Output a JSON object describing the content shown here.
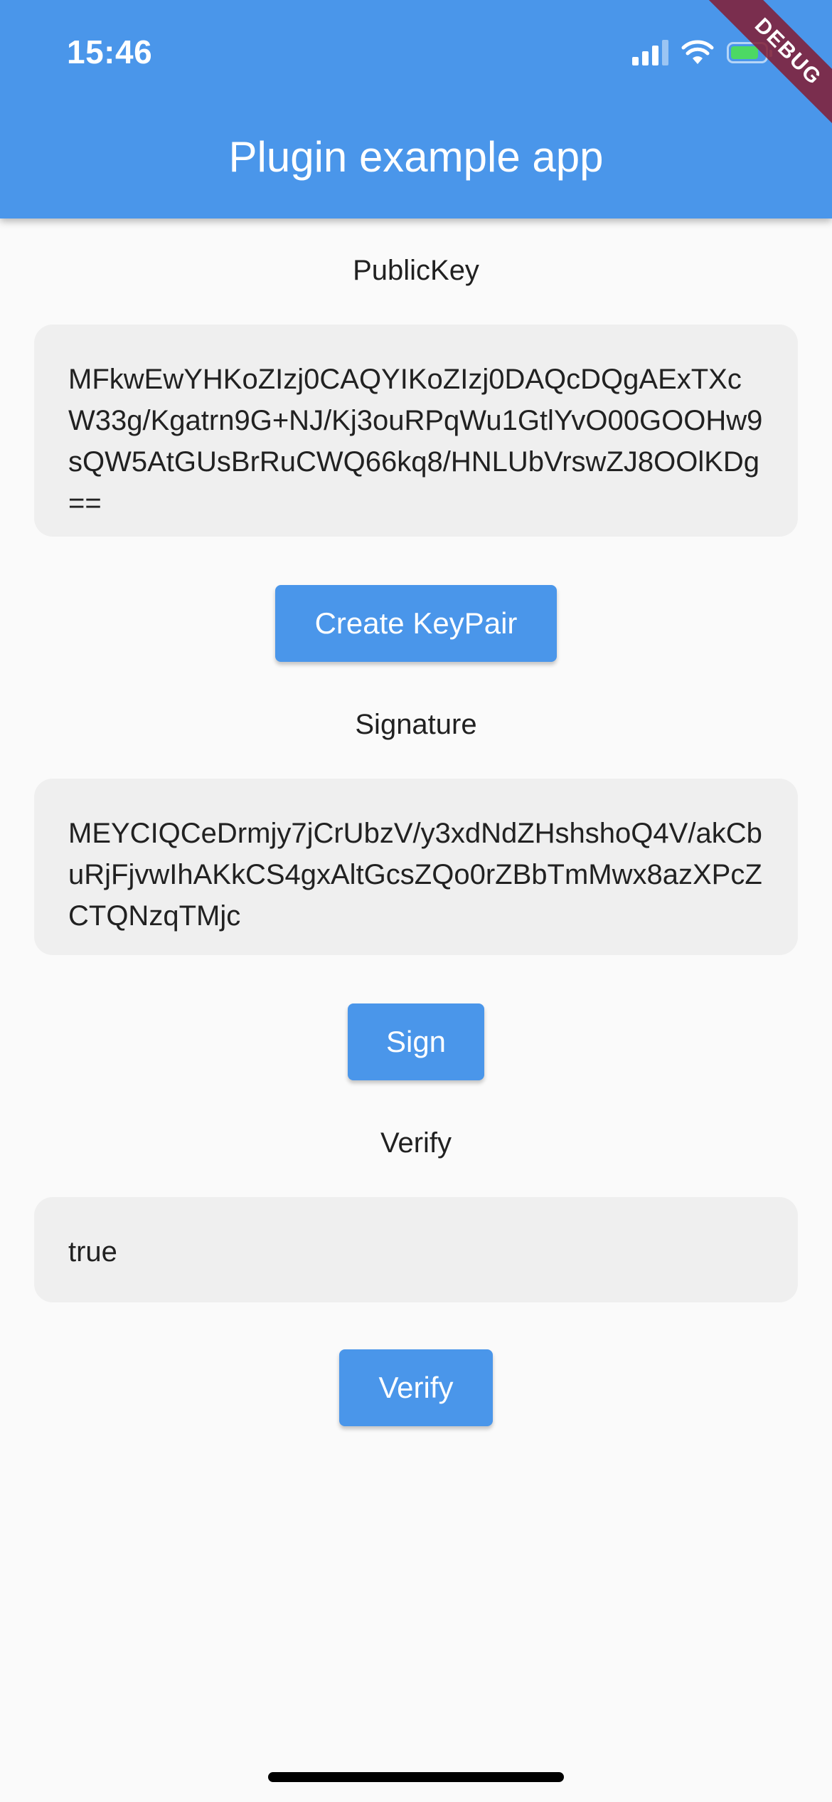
{
  "status_bar": {
    "time": "15:46",
    "icons": [
      "cellular-signal-icon",
      "wifi-icon",
      "battery-charging-icon"
    ]
  },
  "app_bar": {
    "title": "Plugin example app"
  },
  "debug_banner": {
    "label": "DEBUG"
  },
  "public_key": {
    "label": "PublicKey",
    "value": "MFkwEwYHKoZIzj0CAQYIKoZIzj0DAQcDQgAExTXcW33g/Kgatrn9G+NJ/Kj3ouRPqWu1GtlYvO00GOOHw9sQW5AtGUsBrRuCWQ66kq8/HNLUbVrswZJ8OOlKDg==",
    "button_label": "Create KeyPair"
  },
  "signature": {
    "label": "Signature",
    "value": "MEYCIQCeDrmjy7jCrUbzV/y3xdNdZHshshoQ4V/akCbuRjFjvwIhAKkCS4gxAltGcsZQo0rZBbTmMwx8azXPcZCTQNzqTMjc",
    "button_label": "Sign"
  },
  "verify": {
    "label": "Verify",
    "value": "true",
    "button_label": "Verify"
  },
  "colors": {
    "primary": "#4a96ea",
    "background": "#fafafa",
    "field_background": "#efefef",
    "debug_banner": "#821c32"
  }
}
